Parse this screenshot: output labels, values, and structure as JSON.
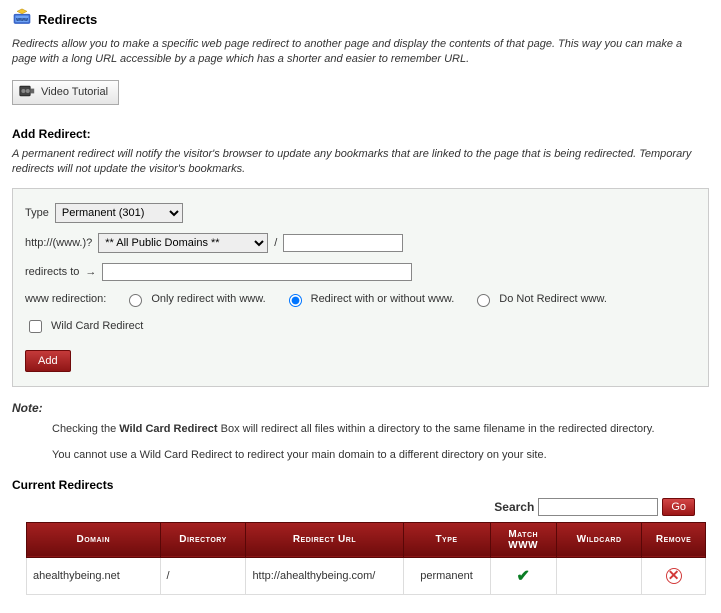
{
  "header": {
    "title": "Redirects",
    "intro": "Redirects allow you to make a specific web page redirect to another page and display the contents of that page. This way you can make a page with a long URL accessible by a page which has a shorter and easier to remember URL.",
    "video_button": "Video Tutorial"
  },
  "add": {
    "heading": "Add Redirect:",
    "description": "A permanent redirect will notify the visitor's browser to update any bookmarks that are linked to the page that is being redirected. Temporary redirects will not update the visitor's bookmarks.",
    "type_label": "Type",
    "type_value": "Permanent (301)",
    "url_prefix": "http://(www.)?",
    "domain_value": "** All Public Domains **",
    "slash": "/",
    "path_value": "",
    "redirects_to_label": "redirects to",
    "redirects_to_value": "",
    "www_label": "www redirection:",
    "www_options": {
      "only": "Only redirect with www.",
      "both": "Redirect with or without www.",
      "none": "Do Not Redirect www."
    },
    "wildcard_label": "Wild Card Redirect",
    "add_button": "Add"
  },
  "note": {
    "heading": "Note:",
    "line1_before": "Checking the ",
    "line1_bold": "Wild Card Redirect",
    "line1_after": " Box will redirect all files within a directory to the same filename in the redirected directory.",
    "line2": "You cannot use a Wild Card Redirect to redirect your main domain to a different directory on your site."
  },
  "current": {
    "heading": "Current Redirects",
    "search_label": "Search",
    "search_value": "",
    "go_button": "Go",
    "columns": {
      "domain": "Domain",
      "directory": "Directory",
      "redirect_url": "Redirect Url",
      "type": "Type",
      "match_www": "Match WWW",
      "wildcard": "Wildcard",
      "remove": "Remove"
    },
    "rows": [
      {
        "domain": "ahealthybeing.net",
        "directory": "/",
        "redirect_url": "http://ahealthybeing.com/",
        "type": "permanent",
        "match_www": true,
        "wildcard": "",
        "remove": true
      }
    ]
  }
}
